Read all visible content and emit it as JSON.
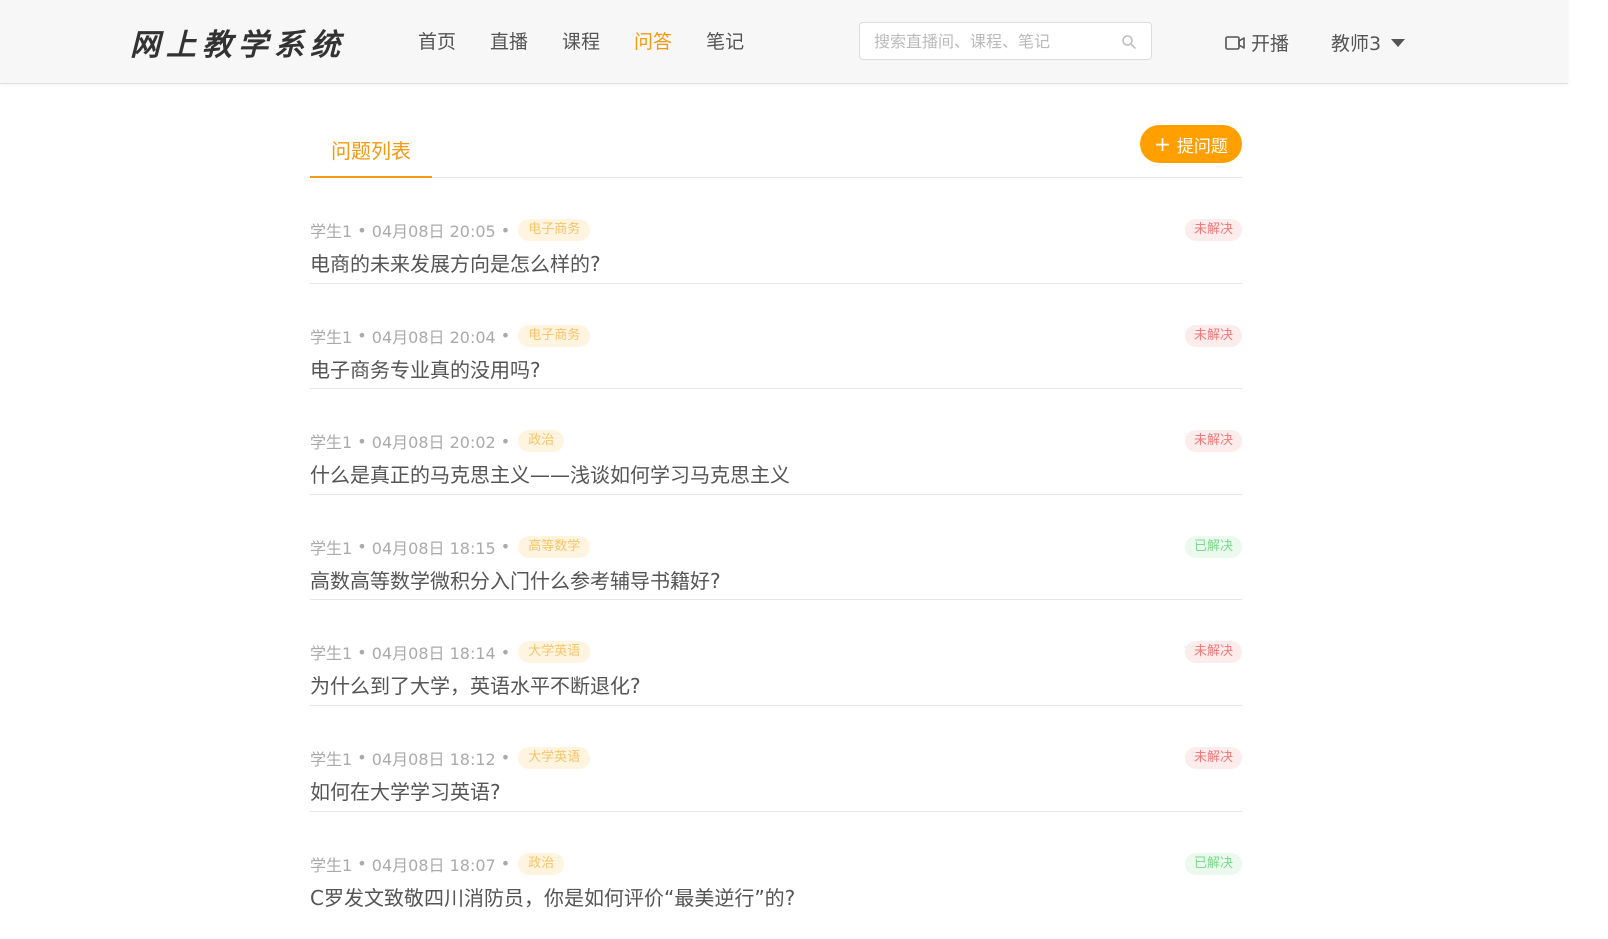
{
  "header": {
    "logo": "网上教学系统",
    "nav": [
      {
        "label": "首页",
        "active": false
      },
      {
        "label": "直播",
        "active": false
      },
      {
        "label": "课程",
        "active": false
      },
      {
        "label": "问答",
        "active": true
      },
      {
        "label": "笔记",
        "active": false
      }
    ],
    "search_placeholder": "搜索直播间、课程、笔记",
    "live_label": "开播",
    "user_name": "教师3"
  },
  "tabs": {
    "active_label": "问题列表"
  },
  "ask_button": {
    "label": "提问题"
  },
  "colors": {
    "accent": "#f39a12",
    "button": "#ff9f00",
    "unsolved": "#f07a7a",
    "solved": "#7bd98a"
  },
  "questions": [
    {
      "author": "学生1",
      "time": "04月08日 20:05",
      "tag": "电子商务",
      "title": "电商的未来发展方向是怎么样的?",
      "status": "未解决",
      "solved": false
    },
    {
      "author": "学生1",
      "time": "04月08日 20:04",
      "tag": "电子商务",
      "title": "电子商务专业真的没用吗?",
      "status": "未解决",
      "solved": false
    },
    {
      "author": "学生1",
      "time": "04月08日 20:02",
      "tag": "政治",
      "title": "什么是真正的马克思主义——浅谈如何学习马克思主义",
      "status": "未解决",
      "solved": false
    },
    {
      "author": "学生1",
      "time": "04月08日 18:15",
      "tag": "高等数学",
      "title": "高数高等数学微积分入门什么参考辅导书籍好?",
      "status": "已解决",
      "solved": true
    },
    {
      "author": "学生1",
      "time": "04月08日 18:14",
      "tag": "大学英语",
      "title": "为什么到了大学，英语水平不断退化?",
      "status": "未解决",
      "solved": false
    },
    {
      "author": "学生1",
      "time": "04月08日 18:12",
      "tag": "大学英语",
      "title": "如何在大学学习英语?",
      "status": "未解决",
      "solved": false
    },
    {
      "author": "学生1",
      "time": "04月08日 18:07",
      "tag": "政治",
      "title": "C罗发文致敬四川消防员，你是如何评价“最美逆行”的?",
      "status": "已解决",
      "solved": true
    }
  ]
}
